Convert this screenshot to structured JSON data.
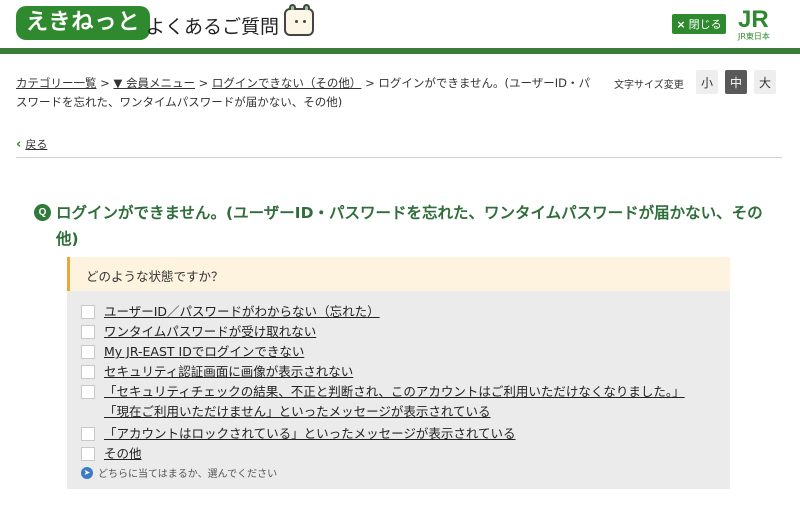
{
  "header": {
    "logo_text": "えきねっと",
    "title": "よくあるご質問",
    "close_label": "閉じる",
    "jr_logo_text": "JR",
    "jr_logo_sub": "JR東日本"
  },
  "breadcrumb": {
    "items": [
      "カテゴリー一覧",
      "▼ 会員メニュー",
      "ログインできない（その他）"
    ],
    "current": "ログインができません。(ユーザーID・パスワードを忘れた、ワンタイムパスワードが届かない、その他)",
    "separator": ">"
  },
  "font_size": {
    "label": "文字サイズ変更",
    "options": [
      "小",
      "中",
      "大"
    ],
    "selected": "中"
  },
  "back_label": "戻る",
  "question": {
    "badge": "Q",
    "title": "ログインができません。(ユーザーID・パスワードを忘れた、ワンタイムパスワードが届かない、その他)"
  },
  "panel": {
    "prompt": "どのような状態ですか？",
    "options": [
      "ユーザーID／パスワードがわからない（忘れた）",
      "ワンタイムパスワードが受け取れない",
      "My JR-EAST IDでログインできない",
      "セキュリティ認証画面に画像が表示されない",
      "「セキュリティチェックの結果、不正と判断され、このアカウントはご利用いただけなくなりました。」",
      "「現在ご利用いただけません」といったメッセージが表示されている",
      "「アカウントはロックされている」といったメッセージが表示されている",
      "その他"
    ],
    "hint": "どちらに当てはまるか、選んでください"
  },
  "colors": {
    "brand_green": "#2f8a2f",
    "title_green": "#2f6e3a",
    "panel_bg": "#ebebeb",
    "prompt_bg": "#fdf3df",
    "prompt_accent": "#e8a83a"
  }
}
